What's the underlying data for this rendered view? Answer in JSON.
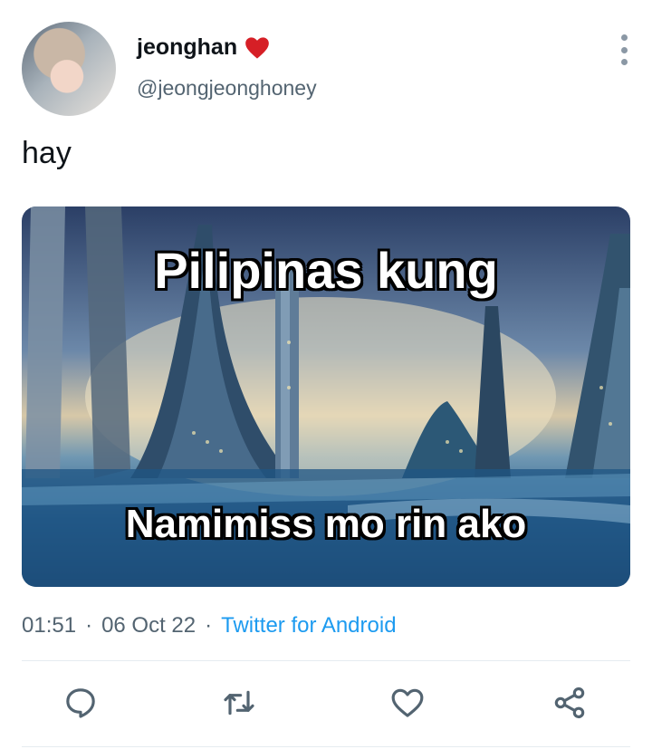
{
  "user": {
    "name": "jeonghan",
    "handle": "@jeongjeonghoney"
  },
  "tweet": {
    "text": "hay",
    "time": "01:51",
    "date": "06 Oct 22",
    "source": "Twitter for Android",
    "separator": "·"
  },
  "media": {
    "caption_top": "Pilipinas kung",
    "caption_bottom": "Namimiss mo rin ako"
  },
  "icons": {
    "heart": "heart-emoji-icon",
    "more": "more-options-icon",
    "reply": "reply-icon",
    "retweet": "retweet-icon",
    "like": "like-icon",
    "share": "share-icon"
  },
  "colors": {
    "accent": "#1d9bf0",
    "heart": "#d61f26",
    "secondary_text": "#536471",
    "icon": "#536471"
  }
}
